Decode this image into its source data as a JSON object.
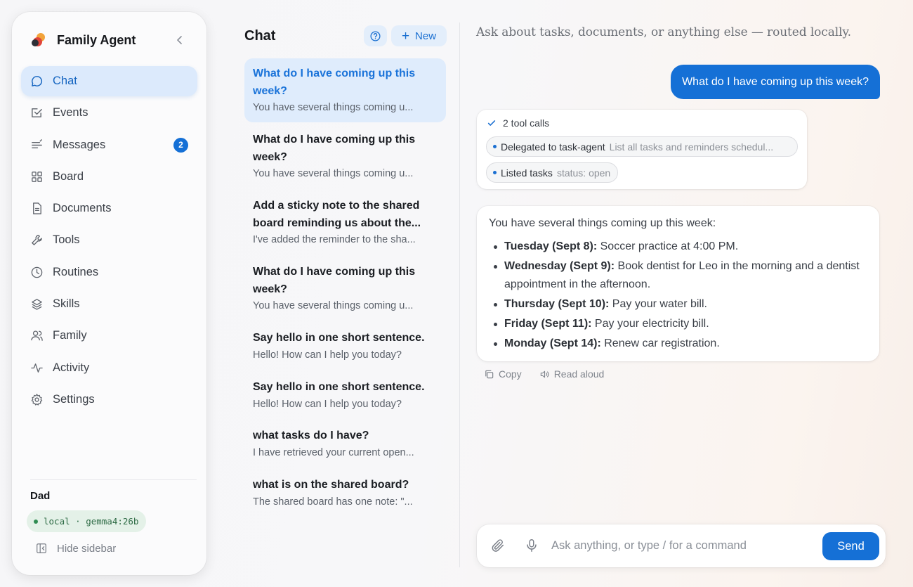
{
  "sidebar": {
    "brand": "Family Agent",
    "items": [
      {
        "label": "Chat",
        "icon": "chat-bubble-icon",
        "active": true
      },
      {
        "label": "Events",
        "icon": "calendar-check-icon"
      },
      {
        "label": "Messages",
        "icon": "messages-icon",
        "badge": "2"
      },
      {
        "label": "Board",
        "icon": "board-grid-icon"
      },
      {
        "label": "Documents",
        "icon": "document-icon"
      },
      {
        "label": "Tools",
        "icon": "wrench-icon"
      },
      {
        "label": "Routines",
        "icon": "clock-icon"
      },
      {
        "label": "Skills",
        "icon": "layers-icon"
      },
      {
        "label": "Family",
        "icon": "users-icon"
      },
      {
        "label": "Activity",
        "icon": "activity-icon"
      },
      {
        "label": "Settings",
        "icon": "gear-icon"
      }
    ],
    "user": "Dad",
    "model": "local · gemma4:26b",
    "hide_label": "Hide sidebar"
  },
  "chat_list": {
    "title": "Chat",
    "new_label": "New",
    "conversations": [
      {
        "title": "What do I have coming up this week?",
        "preview": "You have several things coming u...",
        "active": true
      },
      {
        "title": "What do I have coming up this week?",
        "preview": "You have several things coming u..."
      },
      {
        "title": "Add a sticky note to the shared board reminding us about the...",
        "preview": "I've added the reminder to the sha..."
      },
      {
        "title": "What do I have coming up this week?",
        "preview": "You have several things coming u..."
      },
      {
        "title": "Say hello in one short sentence.",
        "preview": "Hello! How can I help you today?"
      },
      {
        "title": "Say hello in one short sentence.",
        "preview": "Hello! How can I help you today?"
      },
      {
        "title": "what tasks do I have?",
        "preview": "I have retrieved your current open..."
      },
      {
        "title": "what is on the shared board?",
        "preview": "The shared board has one note: \"..."
      }
    ]
  },
  "main": {
    "hint": "Ask about tasks, documents, or anything else — routed locally.",
    "user_message": "What do I have coming up this week?",
    "tools": {
      "summary": "2 tool calls",
      "calls": [
        {
          "name": "Delegated to task-agent",
          "arg": "List all tasks and reminders schedul..."
        },
        {
          "name": "Listed tasks",
          "arg": "status: open"
        }
      ]
    },
    "answer": {
      "intro": "You have several things coming up this week:",
      "items": [
        {
          "day": "Tuesday (Sept 8):",
          "text": " Soccer practice at 4:00 PM."
        },
        {
          "day": "Wednesday (Sept 9):",
          "text": " Book dentist for Leo in the morning and a dentist appointment in the afternoon."
        },
        {
          "day": "Thursday (Sept 10):",
          "text": " Pay your water bill."
        },
        {
          "day": "Friday (Sept 11):",
          "text": " Pay your electricity bill."
        },
        {
          "day": "Monday (Sept 14):",
          "text": " Renew car registration."
        }
      ]
    },
    "actions": {
      "copy": "Copy",
      "read_aloud": "Read aloud"
    },
    "composer": {
      "placeholder": "Ask anything, or type / for a command",
      "send": "Send"
    }
  },
  "colors": {
    "accent": "#1570d6",
    "active_bg": "#dceafc",
    "model_pill": "#e4f1e8"
  }
}
